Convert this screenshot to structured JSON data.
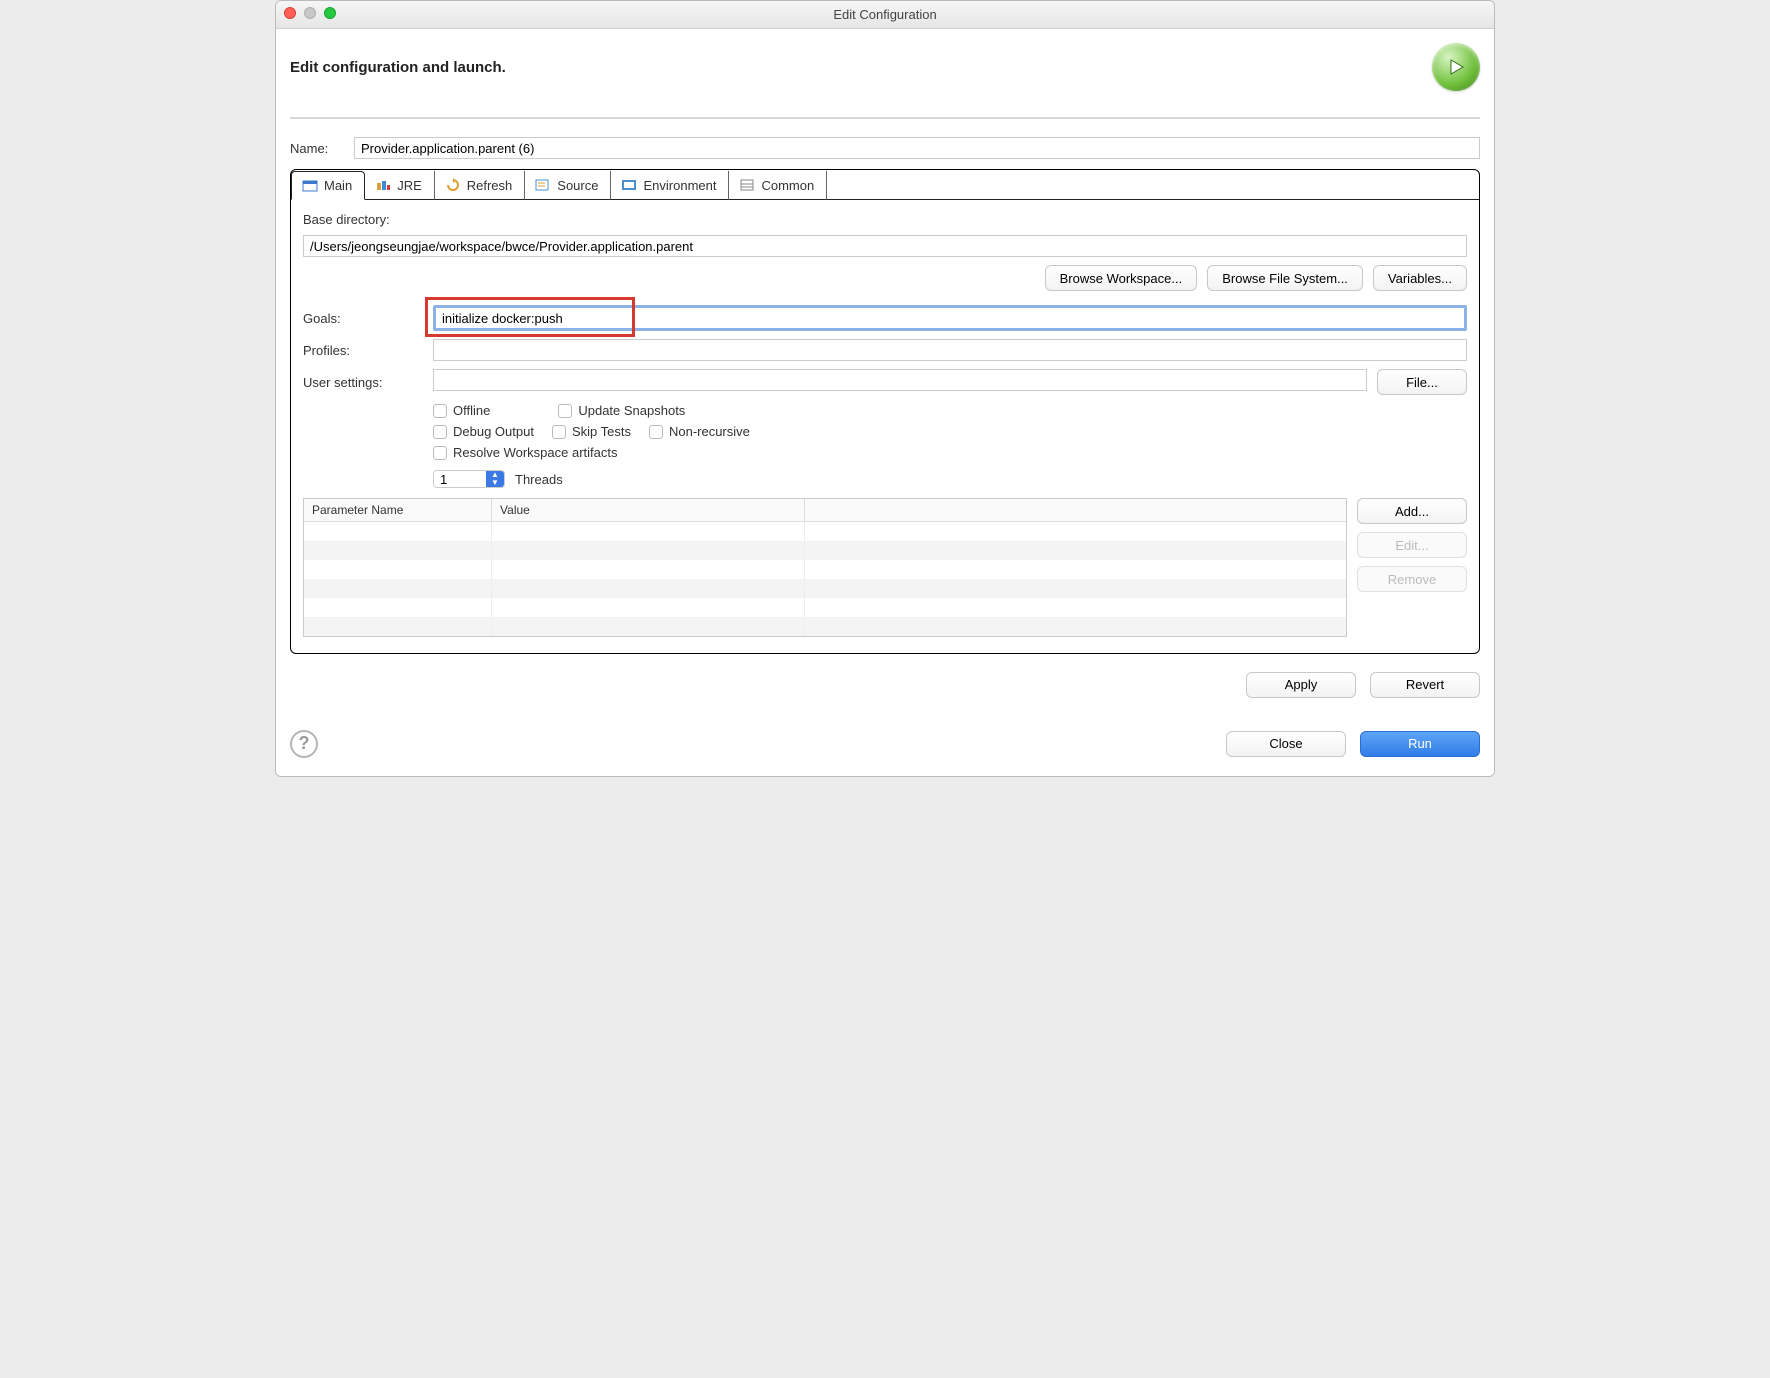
{
  "window": {
    "title": "Edit Configuration"
  },
  "header": {
    "title": "Edit configuration and launch."
  },
  "name": {
    "label": "Name:",
    "value": "Provider.application.parent (6)"
  },
  "tabs": {
    "main": "Main",
    "jre": "JRE",
    "refresh": "Refresh",
    "source": "Source",
    "environment": "Environment",
    "common": "Common"
  },
  "main": {
    "basedir_label": "Base directory:",
    "basedir_value": "/Users/jeongseungjae/workspace/bwce/Provider.application.parent",
    "browse_workspace": "Browse Workspace...",
    "browse_fs": "Browse File System...",
    "variables": "Variables...",
    "goals_label": "Goals:",
    "goals_value": "initialize docker:push",
    "profiles_label": "Profiles:",
    "profiles_value": "",
    "usersettings_label": "User settings:",
    "usersettings_value": "",
    "file_btn": "File...",
    "offline": "Offline",
    "update_snapshots": "Update Snapshots",
    "debug_output": "Debug Output",
    "skip_tests": "Skip Tests",
    "non_recursive": "Non-recursive",
    "resolve_workspace": "Resolve Workspace artifacts",
    "threads_value": "1",
    "threads_label": "Threads",
    "param_name": "Parameter Name",
    "param_value": "Value",
    "add": "Add...",
    "edit": "Edit...",
    "remove": "Remove"
  },
  "footer": {
    "apply": "Apply",
    "revert": "Revert",
    "close": "Close",
    "run": "Run"
  }
}
